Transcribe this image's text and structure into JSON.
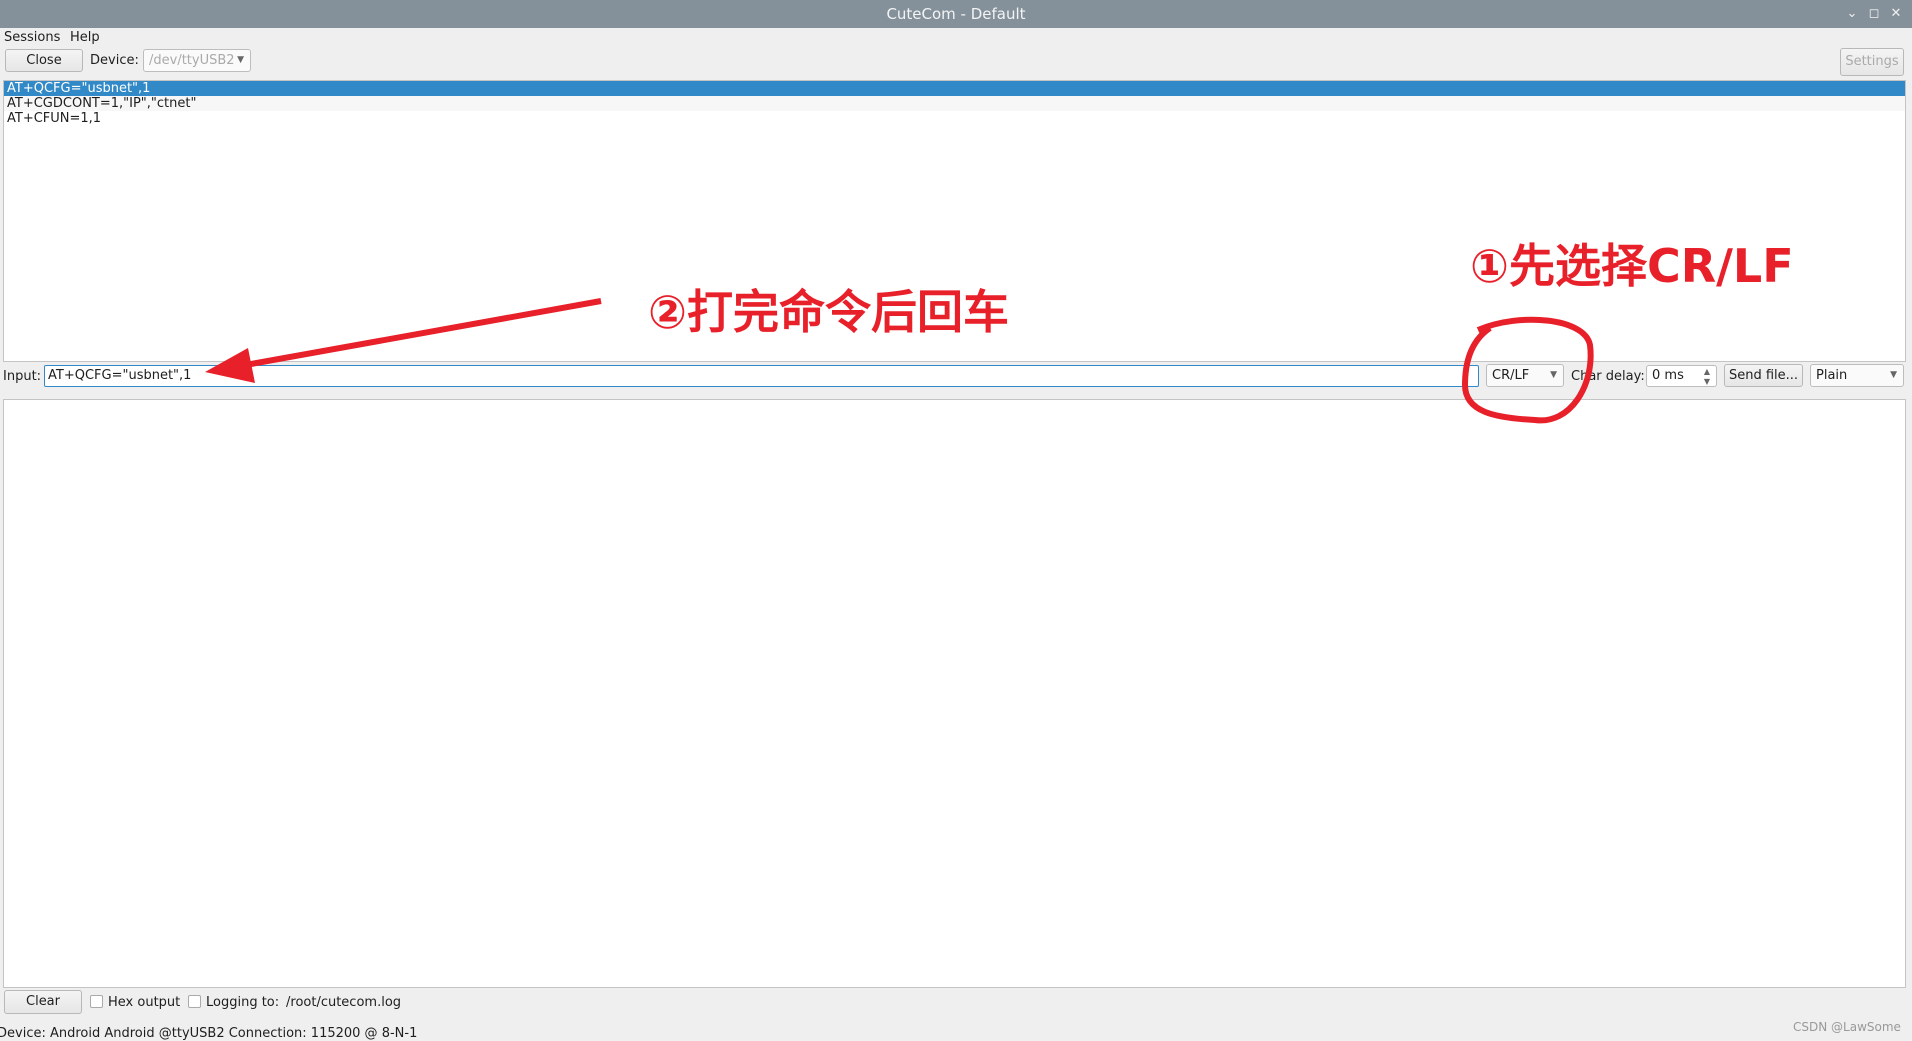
{
  "window": {
    "title": "CuteCom - Default"
  },
  "menu": [
    {
      "label": "Sessions"
    },
    {
      "label": "Help"
    }
  ],
  "toolbar": {
    "close_label": "Close",
    "device_label": "Device:",
    "device_value": "/dev/ttyUSB2",
    "settings_label": "Settings"
  },
  "history": [
    "AT+QCFG=\"usbnet\",1",
    "AT+CGDCONT=1,\"IP\",\"ctnet\"",
    "AT+CFUN=1,1"
  ],
  "input": {
    "label": "Input:",
    "value": "AT+QCFG=\"usbnet\",1",
    "line_end": "CR/LF",
    "char_delay_label": "Char delay:",
    "char_delay_value": "0 ms",
    "send_file_label": "Send file...",
    "format": "Plain"
  },
  "bottom": {
    "clear_label": "Clear",
    "hex_output_label": "Hex output",
    "hex_output_checked": false,
    "logging_label": "Logging to:",
    "logging_checked": false,
    "log_path": "/root/cutecom.log"
  },
  "status": "Device:  Android Android @ttyUSB2  Connection:  115200 @ 8-N-1",
  "annotations": {
    "step1": "①先选择CR/LF",
    "step2": "②打完命令后回车",
    "color": "#e8202a"
  },
  "watermark": "CSDN @LawSome"
}
